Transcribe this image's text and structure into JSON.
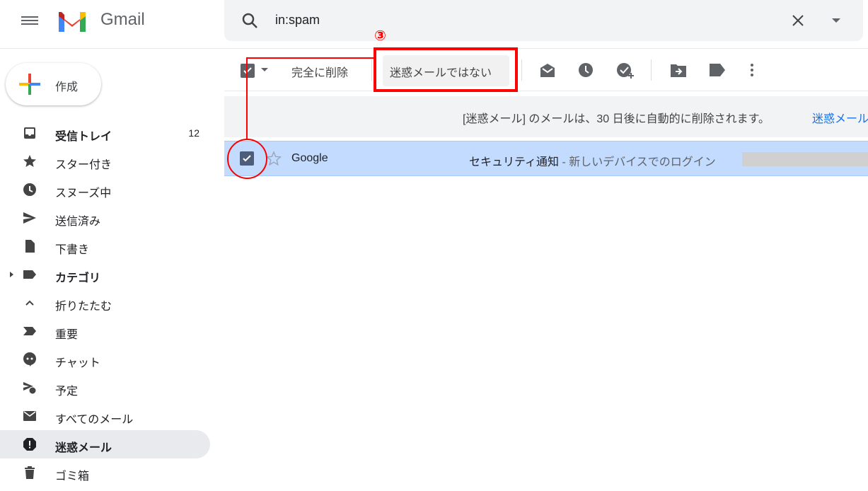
{
  "header": {
    "brand": "Gmail",
    "search_value": "in:spam"
  },
  "compose_label": "作成",
  "sidebar": {
    "items": [
      {
        "label": "受信トレイ",
        "count": "12",
        "bold": true,
        "icon": "inbox-icon"
      },
      {
        "label": "スター付き",
        "icon": "star-icon"
      },
      {
        "label": "スヌーズ中",
        "icon": "clock-icon"
      },
      {
        "label": "送信済み",
        "icon": "send-icon"
      },
      {
        "label": "下書き",
        "icon": "draft-icon"
      },
      {
        "label": "カテゴリ",
        "bold": true,
        "icon": "label-icon"
      },
      {
        "label": "折りたたむ",
        "icon": "chevron-up-icon"
      },
      {
        "label": "重要",
        "icon": "important-icon"
      },
      {
        "label": "チャット",
        "icon": "chat-icon"
      },
      {
        "label": "予定",
        "icon": "scheduled-icon"
      },
      {
        "label": "すべてのメール",
        "icon": "mail-icon"
      },
      {
        "label": "迷惑メール",
        "bold": true,
        "active": true,
        "icon": "spam-icon"
      },
      {
        "label": "ゴミ箱",
        "icon": "trash-icon"
      }
    ]
  },
  "toolbar": {
    "delete_forever": "完全に削除",
    "not_spam": "迷惑メールではない"
  },
  "notice": {
    "text": "[迷惑メール] のメールは、30 日後に自動的に削除されます。",
    "link": "迷惑メール"
  },
  "email": {
    "sender": "Google",
    "subject": "セキュリティ通知",
    "snippet": " - 新しいデバイスでのログイン"
  },
  "annotation": {
    "step": "③",
    "color": "#ff0000"
  }
}
